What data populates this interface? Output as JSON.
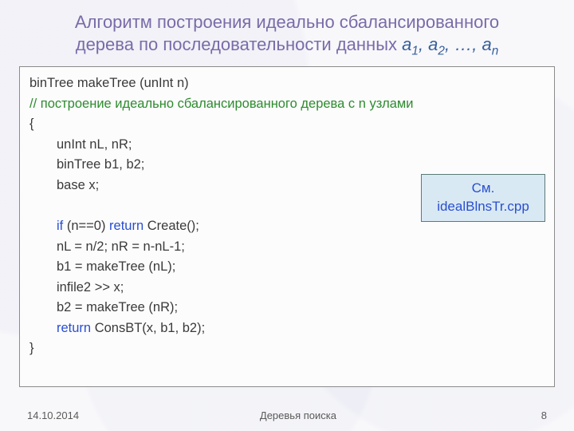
{
  "title": {
    "line1": "Алгоритм построения идеально сбалансированного",
    "line2_pre": "дерева по последовательности данных ",
    "seq": "a₁, a₂, …, aₙ"
  },
  "code": {
    "l1": "binTree makeTree (unInt n)",
    "l2": "// построение идеально сбалансированного дерева с n узлами",
    "l3": "{",
    "l4": "unInt  nL, nR;",
    "l5": "binTree   b1, b2;",
    "l6": "base x;",
    "l7_if": "if",
    "l7_rest1": " (n==0) ",
    "l7_return": "return",
    "l7_rest2": " Create();",
    "l8": "nL = n/2;  nR = n-nL-1;",
    "l9": "b1 = makeTree (nL);",
    "l10": "infile2 >> x;",
    "l11": "b2 = makeTree (nR);",
    "l12_return": "return",
    "l12_rest": " ConsBT(x, b1, b2);",
    "l13": "}"
  },
  "note": {
    "line1": "См.",
    "line2": "idealBlnsTr.cpp"
  },
  "footer": {
    "date": "14.10.2014",
    "subject": "Деревья поиска",
    "page": "8"
  }
}
